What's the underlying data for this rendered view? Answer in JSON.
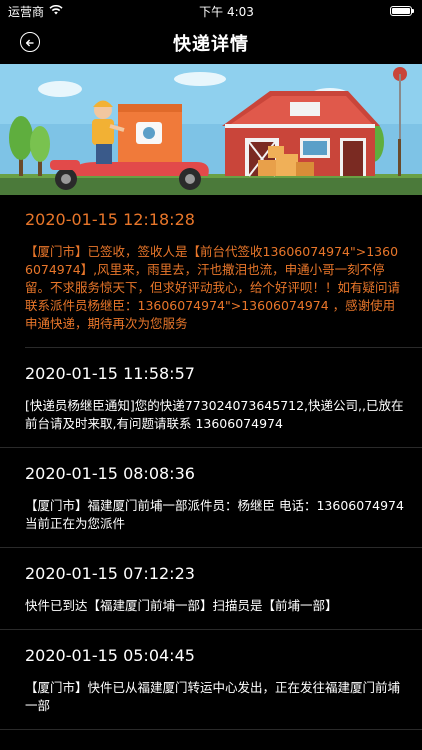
{
  "status_bar": {
    "carrier": "运营商",
    "time": "下午 4:03",
    "battery_level": 1.0
  },
  "nav": {
    "title": "快递详情",
    "back_icon": "back-arrow-icon"
  },
  "colors": {
    "background": "#000000",
    "latest_text": "#e8762a",
    "text": "#ffffff",
    "separator": "#2a2a2a"
  },
  "tracking": [
    {
      "time": "2020-01-15 12:18:28",
      "text": "【厦门市】已签收，签收人是【前台代签收13606074974\">13606074974】,风里来，雨里去，汗也撒泪也流，申通小哥一刻不停留。不求服务惊天下，但求好评动我心，给个好评呗！！如有疑问请联系派件员杨继臣：13606074974\">13606074974 ，感谢使用申通快递，期待再次为您服务"
    },
    {
      "time": "2020-01-15 11:58:57",
      "text": "[快递员杨继臣通知]您的快递773024073645712,快递公司,,已放在前台请及时来取,有问题请联系 13606074974"
    },
    {
      "time": "2020-01-15 08:08:36",
      "text": "【厦门市】福建厦门前埔一部派件员：杨继臣 电话：13606074974 当前正在为您派件"
    },
    {
      "time": "2020-01-15 07:12:23",
      "text": "快件已到达【福建厦门前埔一部】扫描员是【前埔一部】"
    },
    {
      "time": "2020-01-15 05:04:45",
      "text": "【厦门市】快件已从福建厦门转运中心发出，正在发往福建厦门前埔一部"
    }
  ]
}
